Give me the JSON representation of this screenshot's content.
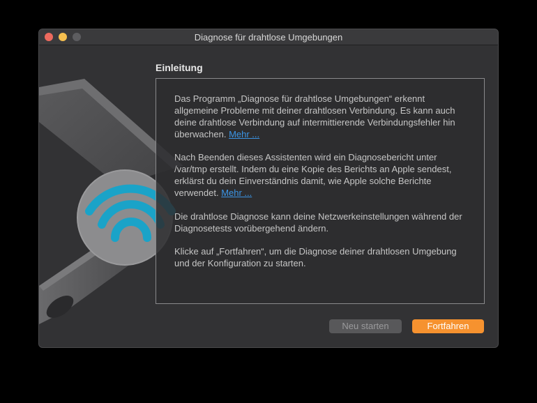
{
  "window": {
    "title": "Diagnose für drahtlose Umgebungen"
  },
  "section": {
    "heading": "Einleitung"
  },
  "content": {
    "paragraph1": {
      "text": "Das Programm „Diagnose für drahtlose Umgebungen“ erkennt allgemeine Probleme mit deiner drahtlosen Verbindung. Es kann auch deine drahtlose Verbindung auf intermittierende Verbindungsfehler hin überwachen. ",
      "link": "Mehr ..."
    },
    "paragraph2": {
      "text": "Nach Beenden dieses Assistenten wird ein Diagnosebericht unter /var/tmp erstellt. Indem du eine Kopie des Berichts an Apple sendest, erklärst du dein Einverständnis damit, wie Apple solche Berichte verwendet. ",
      "link": "Mehr ..."
    },
    "paragraph3": {
      "text": "Die drahtlose Diagnose kann deine Netzwerkeinstellungen während der Diagnosetests vorübergehend ändern."
    },
    "paragraph4": {
      "text": "Klicke auf „Fortfahren“, um die Diagnose deiner drahtlosen Umgebung und der Konfiguration zu starten."
    }
  },
  "buttons": {
    "restart": "Neu starten",
    "continue": "Fortfahren"
  },
  "colors": {
    "accent": "#f6922f",
    "link": "#3b95e6",
    "wifi": "#1aa3c8"
  },
  "icons": {
    "artwork": "wireless-diagnostics-wrench-icon"
  }
}
